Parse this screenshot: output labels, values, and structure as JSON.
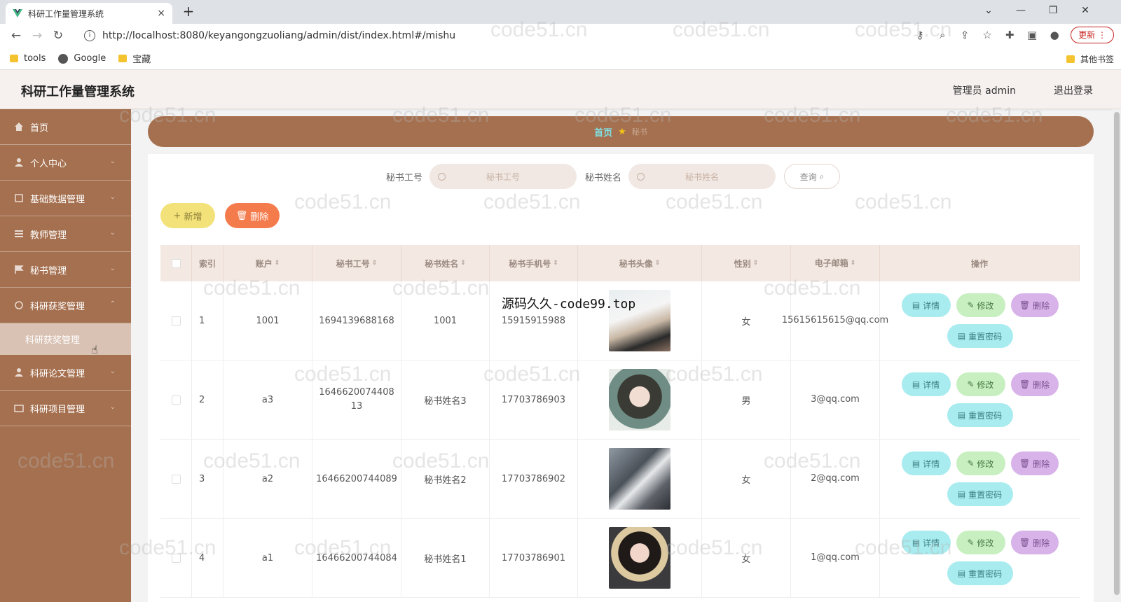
{
  "browser": {
    "tab_title": "科研工作量管理系统",
    "tab_close": "×",
    "new_tab": "+",
    "url": "http://localhost:8080/keyangongzuoliang/admin/dist/index.html#/mishu",
    "update_label": "更新",
    "bookmarks": [
      "tools",
      "Google",
      "宝藏"
    ],
    "other_bookmarks": "其他书签",
    "win_minimize": "—",
    "win_restore": "❐",
    "win_close": "✕",
    "win_dropdown": "⌄"
  },
  "header": {
    "title": "科研工作量管理系统",
    "user": "管理员 admin",
    "logout": "退出登录"
  },
  "sidebar": {
    "items": [
      {
        "label": "首页",
        "icon": "home-icon"
      },
      {
        "label": "个人中心",
        "icon": "user-icon"
      },
      {
        "label": "基础数据管理",
        "icon": "database-icon"
      },
      {
        "label": "教师管理",
        "icon": "list-icon"
      },
      {
        "label": "秘书管理",
        "icon": "flag-icon"
      },
      {
        "label": "科研获奖管理",
        "icon": "award-icon"
      }
    ],
    "sub_item": "科研获奖管理",
    "items_after": [
      {
        "label": "科研论文管理",
        "icon": "user-icon"
      },
      {
        "label": "科研项目管理",
        "icon": "folder-icon"
      }
    ]
  },
  "breadcrumb": {
    "home": "首页",
    "current": "秘书"
  },
  "search": {
    "no_label": "秘书工号",
    "no_placeholder": "秘书工号",
    "name_label": "秘书姓名",
    "name_placeholder": "秘书姓名",
    "query_label": "查询"
  },
  "actions": {
    "add_label": "新增",
    "delete_label": "删除"
  },
  "table": {
    "headers": [
      "索引",
      "账户",
      "秘书工号",
      "秘书姓名",
      "秘书手机号",
      "秘书头像",
      "性别",
      "电子邮箱",
      "操作"
    ],
    "rows": [
      {
        "index": "1",
        "account": "1001",
        "no": "1694139688168",
        "name": "1001",
        "phone": "15915915988",
        "sex": "女",
        "email": "15615615615@qq.com"
      },
      {
        "index": "2",
        "account": "a3",
        "no": "164662007440813",
        "name": "秘书姓名3",
        "phone": "17703786903",
        "sex": "男",
        "email": "3@qq.com"
      },
      {
        "index": "3",
        "account": "a2",
        "no": "16466200744089",
        "name": "秘书姓名2",
        "phone": "17703786902",
        "sex": "女",
        "email": "2@qq.com"
      },
      {
        "index": "4",
        "account": "a1",
        "no": "16466200744084",
        "name": "秘书姓名1",
        "phone": "17703786901",
        "sex": "女",
        "email": "1@qq.com"
      }
    ],
    "op_detail": "详情",
    "op_edit": "修改",
    "op_delete": "删除",
    "op_reset": "重置密码"
  },
  "overlay_text": "源码久久-code99.top",
  "watermark": "code51.cn",
  "colors": {
    "sidebar": "#a5704f",
    "breadcrumb": "#a5704f",
    "add_button": "#f3e27a",
    "delete_button": "#f47c4c",
    "detail_button": "#a9ecef",
    "edit_button": "#c7efc0",
    "delete_op_button": "#d8b3ea"
  }
}
